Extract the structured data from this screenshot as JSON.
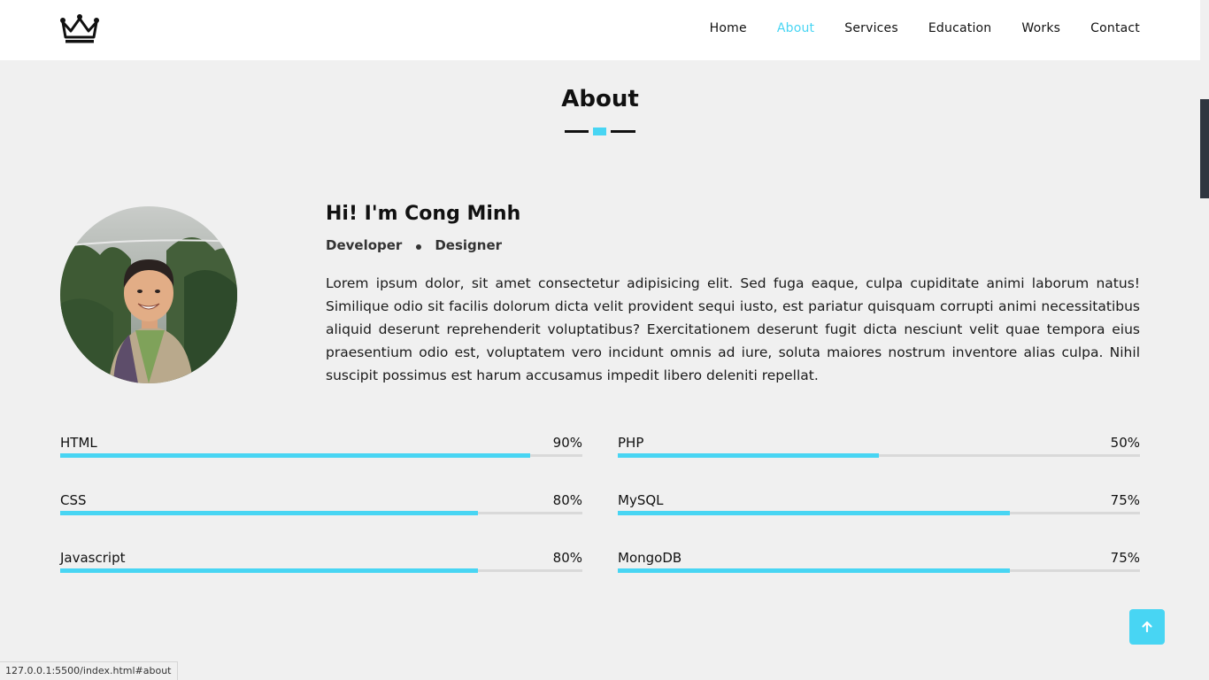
{
  "nav": {
    "logo_icon": "crown-icon",
    "links": [
      {
        "label": "Home",
        "active": false
      },
      {
        "label": "About",
        "active": true
      },
      {
        "label": "Services",
        "active": false
      },
      {
        "label": "Education",
        "active": false
      },
      {
        "label": "Works",
        "active": false
      },
      {
        "label": "Contact",
        "active": false
      }
    ]
  },
  "section": {
    "title": "About"
  },
  "intro": {
    "heading": "Hi! I'm Cong Minh",
    "roles": [
      "Developer",
      "Designer"
    ],
    "bio": "Lorem ipsum dolor, sit amet consectetur adipisicing elit. Sed fuga eaque, culpa cupiditate animi laborum natus! Similique odio sit facilis dolorum dicta velit provident sequi iusto, est pariatur quisquam corrupti animi necessitatibus aliquid deserunt reprehenderit voluptatibus? Exercitationem deserunt fugit dicta nesciunt velit quae tempora eius praesentium odio est, voluptatem vero incidunt omnis ad iure, soluta maiores nostrum inventore alias culpa. Nihil suscipit possimus est harum accusamus impedit libero deleniti repellat."
  },
  "skills": [
    {
      "name": "HTML",
      "value": "90%",
      "percent": 90
    },
    {
      "name": "PHP",
      "value": "50%",
      "percent": 50
    },
    {
      "name": "CSS",
      "value": "80%",
      "percent": 80
    },
    {
      "name": "MySQL",
      "value": "75%",
      "percent": 75
    },
    {
      "name": "Javascript",
      "value": "80%",
      "percent": 80
    },
    {
      "name": "MongoDB",
      "value": "75%",
      "percent": 75
    }
  ],
  "back_to_top": {
    "icon": "arrow-up-icon"
  },
  "status_bar": {
    "url": "127.0.0.1:5500/index.html#about"
  },
  "colors": {
    "accent": "#48d5f3",
    "background": "#f0f0f0",
    "text": "#111111"
  }
}
